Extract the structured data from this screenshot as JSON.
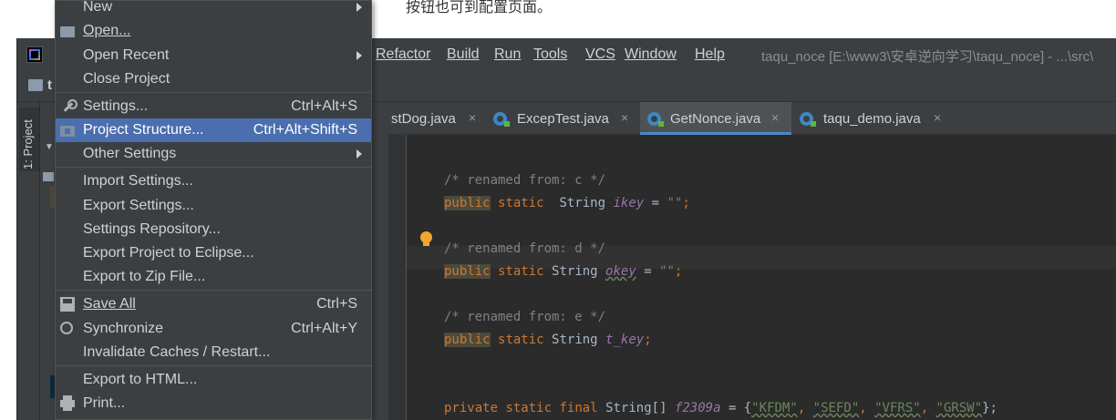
{
  "web": {
    "text": "按钮也可到配置页面。"
  },
  "ide": {
    "menubar": [
      {
        "label": "Refactor",
        "key": "refactor"
      },
      {
        "label": "Build",
        "key": "build"
      },
      {
        "label": "Run",
        "key": "run"
      },
      {
        "label": "Tools",
        "key": "tools"
      },
      {
        "label": "VCS",
        "key": "vcs"
      },
      {
        "label": "Window",
        "key": "window"
      },
      {
        "label": "Help",
        "key": "help"
      }
    ],
    "window_title": "taqu_noce [E:\\www3\\安卓逆向学习\\taqu_noce] - ...\\src\\",
    "navbar_label": "t",
    "project_tool": "1: Project"
  },
  "tabs": [
    {
      "label": "stDog.java",
      "active": false
    },
    {
      "label": "ExcepTest.java",
      "active": false
    },
    {
      "label": "GetNonce.java",
      "active": true
    },
    {
      "label": "taqu_demo.java",
      "active": false
    }
  ],
  "tab_close_glyph": "×",
  "code": {
    "l1_comment": "/* renamed from: c */",
    "l2_kw1": "public",
    "l2_kw2": "static",
    "l2_type": "String",
    "l2_field": "ikey",
    "l2_eq": " = ",
    "l2_str": "\"\"",
    "l2_end": ";",
    "l3_comment": "/* renamed from: d */",
    "l4_kw1": "public",
    "l4_kw2": "static",
    "l4_type": "String",
    "l4_field": "okey",
    "l4_eq": " = ",
    "l4_str": "\"\"",
    "l4_end": ";",
    "l5_comment": "/* renamed from: e */",
    "l6_kw1": "public",
    "l6_kw2": "static",
    "l6_type": "String",
    "l6_field": "t_key",
    "l6_end": ";",
    "l7_kw1": "private",
    "l7_kw2": "static",
    "l7_kw3": "final",
    "l7_type": "String[]",
    "l7_field": "f2309a",
    "l7_eq": " = {",
    "l7_s1": "\"KFDM\"",
    "l7_s2": "\"SEFD\"",
    "l7_s3": "\"VFRS\"",
    "l7_s4": "\"GRSW\"",
    "l7_comma": ", ",
    "l7_end": "};"
  },
  "file_menu": {
    "new": "New",
    "open": "Open...",
    "open_recent": "Open Recent",
    "close_project": "Close Project",
    "settings": "Settings...",
    "settings_shortcut": "Ctrl+Alt+S",
    "project_structure": "Project Structure...",
    "project_structure_shortcut": "Ctrl+Alt+Shift+S",
    "other_settings": "Other Settings",
    "import_settings": "Import Settings...",
    "export_settings": "Export Settings...",
    "settings_repository": "Settings Repository...",
    "export_eclipse": "Export Project to Eclipse...",
    "export_zip": "Export to Zip File...",
    "save_all": "Save All",
    "save_all_shortcut": "Ctrl+S",
    "synchronize": "Synchronize",
    "synchronize_shortcut": "Ctrl+Alt+Y",
    "invalidate_caches": "Invalidate Caches / Restart...",
    "export_html": "Export to HTML...",
    "print": "Print..."
  },
  "colors": {
    "menu_bg": "#3c3f41",
    "selection": "#4b6eaf",
    "editor_bg": "#2b2b2b",
    "keyword": "#cc7832",
    "string": "#6a8759",
    "field": "#9876aa",
    "comment": "#808080"
  }
}
